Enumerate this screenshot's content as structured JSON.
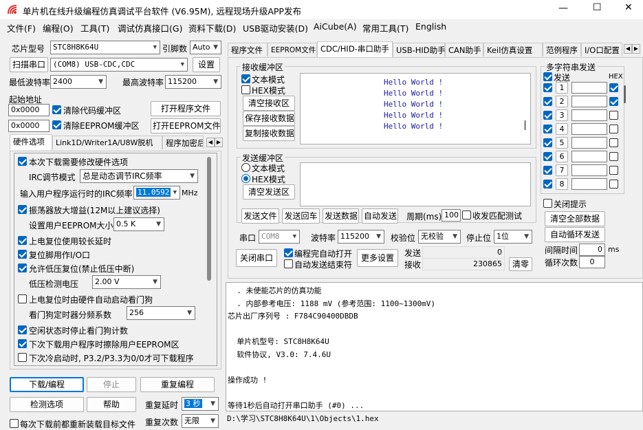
{
  "window": {
    "title": "单片机在线升级编程仿真调试平台软件 (V6.95M), 远程现场升级APP发布",
    "controls": [
      "—",
      "☐",
      "✕"
    ]
  },
  "menu": [
    "文件(F)",
    "编程(O)",
    "工具(T)",
    "调试仿真接口(G)",
    "资料下载(D)",
    "USB驱动安装(D)",
    "AiCube(A)",
    "常用工具(T)",
    "English"
  ],
  "left": {
    "chip_label": "芯片型号",
    "chip_value": "STC8H8K64U",
    "pins_label": "引脚数",
    "pins_value": "Auto",
    "scan_label": "扫描串口",
    "port_value": "(COM8) USB-CDC,CDC",
    "settings_label": "设置",
    "min_baud_label": "最低波特率",
    "min_baud_value": "2400",
    "max_baud_label": "最高波特率",
    "max_baud_value": "115200",
    "start_addr_label": "起始地址",
    "addr1": "0x0000",
    "clear_code_label": "清除代码缓冲区",
    "open_prog_label": "打开程序文件",
    "addr2": "0x0000",
    "clear_eeprom_label": "清除EEPROM缓冲区",
    "open_eeprom_label": "打开EEPROM文件",
    "tabs": [
      "硬件选项",
      "Link1D/Writer1A/U8W脱机",
      "程序加密后"
    ],
    "hw": {
      "modify_hw": "本次下载需要修改硬件选项",
      "irc_mode_label": "IRC调节模式",
      "irc_mode_value": "总是动态调节IRC频率",
      "irc_freq_label": "输入用户程序运行时的IRC频率",
      "irc_freq_value": "11.0592",
      "mhz": "MHz",
      "osc_gain": "振荡器放大增益(12M以上建议选择)",
      "eeprom_size_label": "设置用户EEPROM大小",
      "eeprom_size_value": "0.5 K",
      "power_delay": "上电复位使用较长延时",
      "reset_io": "复位脚用作I/O口",
      "lvr": "允许低压复位(禁止低压中断)",
      "lvd_label": "低压检测电压",
      "lvd_value": "2.00 V",
      "wdt_hw": "上电复位时由硬件自动启动看门狗",
      "wdt_div_label": "看门狗定时器分频系数",
      "wdt_div_value": "256",
      "idle_wdt": "空闲状态时停止看门狗计数",
      "erase_eeprom": "下次下载用户程序时擦除用户EEPROM区",
      "cold_boot": "下次冷启动时, P3.2/P3.3为0/0才可下载程序"
    },
    "download_label": "下载/编程",
    "stop_label": "停止",
    "reprog_label": "重复编程",
    "check_label": "检测选项",
    "help_label": "帮助",
    "repeat_delay_label": "重复延时",
    "repeat_delay_value": "3 秒",
    "reload_label": "每次下载前都重新装载目标文件",
    "repeat_count_label": "重复次数",
    "repeat_count_value": "无限"
  },
  "right_tabs": [
    "程序文件",
    "EEPROM文件",
    "CDC/HID-串口助手",
    "USB-HID助手",
    "CAN助手",
    "Keil仿真设置",
    "范例程序",
    "I/O口配置"
  ],
  "recv": {
    "group": "接收缓冲区",
    "text_mode": "文本模式",
    "hex_mode": "HEX模式",
    "clear": "清空接收区",
    "save": "保存接收数据",
    "copy": "复制接收数据",
    "lines": [
      "Hello World !",
      "Hello World !",
      "Hello World !",
      "Hello World !",
      "Hello World !"
    ]
  },
  "send": {
    "group": "发送缓冲区",
    "text_mode": "文本模式",
    "hex_mode": "HEX模式",
    "clear": "清空发送区",
    "send_file": "发送文件",
    "send_return": "发送回车",
    "send_data": "发送数据",
    "auto_send": "自动发送",
    "period_label": "周期(ms)",
    "period_value": "100",
    "match_label": "收发匹配测试"
  },
  "multi": {
    "group": "多字符串发送",
    "send_hdr": "发送",
    "hex_hdr": "HEX",
    "rows": [
      {
        "n": "1",
        "hex": true
      },
      {
        "n": "2",
        "hex": true
      },
      {
        "n": "3",
        "hex": false
      },
      {
        "n": "4",
        "hex": false
      },
      {
        "n": "5",
        "hex": false
      },
      {
        "n": "6",
        "hex": false
      },
      {
        "n": "7",
        "hex": false
      },
      {
        "n": "8",
        "hex": false
      }
    ],
    "close_tip": "关闭提示",
    "clear_all": "清空全部数据",
    "auto_loop": "自动循环发送",
    "interval_label": "间隔时间",
    "interval_value": "0",
    "interval_unit": "ms",
    "loop_label": "循环次数",
    "loop_value": "0"
  },
  "serial": {
    "port_label": "串口",
    "port_value": "COM8",
    "baud_label": "波特率",
    "baud_value": "115200",
    "parity_label": "校验位",
    "parity_value": "无校验",
    "stop_label": "停止位",
    "stop_value": "1位",
    "close_port": "关闭串口",
    "auto_open": "编程完自动打开",
    "auto_end": "自动发送结束符",
    "more": "更多设置",
    "tx_label": "发送",
    "tx_value": "0",
    "rx_label": "接收",
    "rx_value": "230865",
    "clear_count": "清零"
  },
  "log": [
    "  . 未使能芯片的仿真功能",
    "  . 内部参考电压: 1188 mV (参考范围: 1100~1300mV)",
    "芯片出厂序列号 : F784C90400DBDB",
    "",
    "  单片机型号: STC8H8K64U",
    "  软件协议, V3.0: 7.4.6U",
    "",
    "操作成功 !",
    "",
    "等待1秒后自动打开串口助手 (#0) ..."
  ],
  "status_path": "D:\\学习\\STC8H8K64U\\1\\Objects\\1.hex",
  "colors": {
    "accent": "#0067c0",
    "hello_text": "#1a1aa8"
  }
}
